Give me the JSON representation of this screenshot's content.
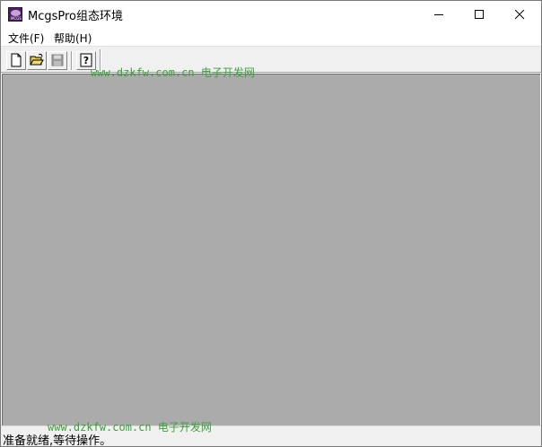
{
  "window": {
    "title": "McgsPro组态环境",
    "icon_name": "mcgs-app-icon",
    "icon_caption": "MCGS"
  },
  "menu": {
    "items": [
      {
        "label": "文件(F)"
      },
      {
        "label": "帮助(H)"
      }
    ]
  },
  "toolbar": {
    "buttons": [
      {
        "icon": "new-file-icon"
      },
      {
        "icon": "open-folder-icon"
      },
      {
        "icon": "save-disk-icon"
      },
      {
        "icon": "help-icon"
      }
    ]
  },
  "status": {
    "text": "准备就绪,等待操作。"
  },
  "watermark": {
    "text": "www.dzkfw.com.cn 电子开发网"
  },
  "colors": {
    "client_background": "#ababab",
    "watermark": "#3aa13a"
  }
}
